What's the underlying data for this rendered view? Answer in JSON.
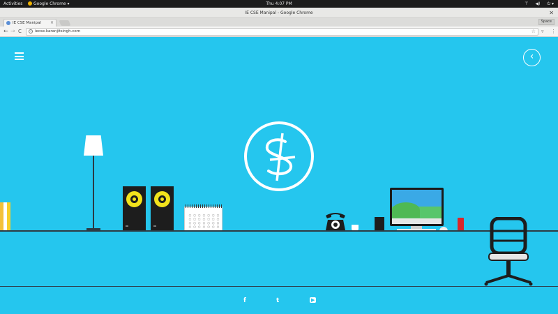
{
  "system_bar": {
    "activities": "Activities",
    "app_menu": "Google Chrome ▾",
    "clock": "Thu  4:07 PM",
    "tray_network": "⊤",
    "tray_volume": "◀)",
    "tray_power": "⏻ ▾"
  },
  "window": {
    "title": "IE CSE Manipal - Google Chrome",
    "close": "✕"
  },
  "tabs": [
    {
      "label": "IE CSE Manipal",
      "close": "×"
    }
  ],
  "user_button": "Space",
  "toolbar": {
    "back": "←",
    "forward": "→",
    "reload": "C",
    "url": "iecse.karanjitsingh.com",
    "star": "☆",
    "ext1": "▿",
    "ext2": "⋮"
  },
  "page": {
    "back_circle": "‹",
    "social": {
      "facebook": "f",
      "twitter": "t",
      "youtube": "▶"
    }
  },
  "colors": {
    "background": "#25c6ee",
    "speaker_cone": "#f2e21c",
    "can": "#d9262b"
  }
}
